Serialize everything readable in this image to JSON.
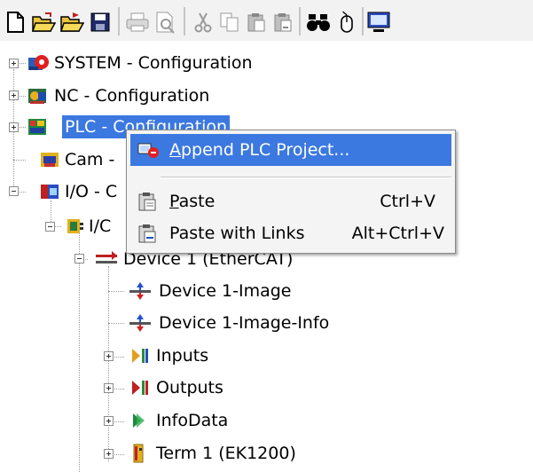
{
  "toolbar": {
    "buttons": [
      "new-icon",
      "open-icon",
      "open-folder-icon",
      "save-icon",
      "print-icon",
      "print-preview-icon",
      "cut-icon",
      "copy-icon",
      "paste-icon",
      "paste-links-icon",
      "find-icon",
      "mouse-icon",
      "monitor-icon"
    ]
  },
  "tree": {
    "system": "SYSTEM - Configuration",
    "nc": "NC - Configuration",
    "plc": "PLC - Configuration",
    "cam": "Cam -",
    "io": "I/O - C",
    "io_devices": "I/C",
    "device1": "Device 1 (EtherCAT)",
    "device1_image": "Device 1-Image",
    "device1_image_info": "Device 1-Image-Info",
    "inputs": "Inputs",
    "outputs": "Outputs",
    "infodata": "InfoData",
    "term1": "Term 1 (EK1200)"
  },
  "context_menu": {
    "append_plc": {
      "mnemonic": "A",
      "rest": "ppend PLC Project..."
    },
    "paste": {
      "mnemonic": "P",
      "rest": "aste",
      "shortcut": "Ctrl+V"
    },
    "paste_links": {
      "label": "Paste with Links",
      "shortcut": "Alt+Ctrl+V"
    }
  },
  "colors": {
    "selection": "#3b78e0"
  }
}
